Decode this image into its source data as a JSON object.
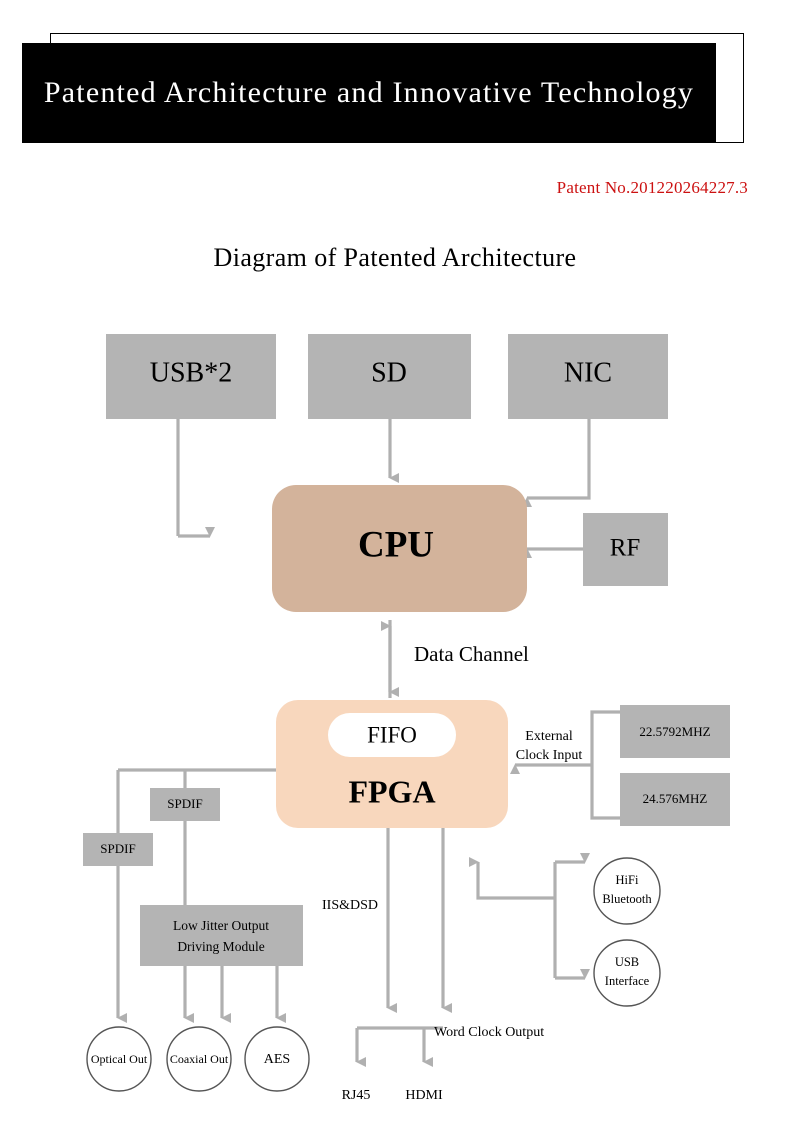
{
  "header": {
    "title": "Patented Architecture and Innovative Technology",
    "banner_bg": "#000000",
    "banner_text_color": "#ffffff"
  },
  "patent": {
    "label": "Patent No.201220264227.3",
    "color": "#cc1111"
  },
  "diagram": {
    "title": "Diagram of Patented Architecture",
    "colors": {
      "gray_box": "#b4b4b4",
      "cpu_fill": "#d3b39b",
      "fpga_fill": "#f8d7bd",
      "fifo_fill": "#ffffff",
      "connector": "#b0b0b0",
      "circle_stroke": "#555555"
    },
    "nodes": {
      "usb": "USB*2",
      "sd": "SD",
      "nic": "NIC",
      "cpu": "CPU",
      "rf": "RF",
      "fifo": "FIFO",
      "fpga": "FPGA",
      "clock_a": "22.5792MHZ",
      "clock_b": "24.576MHZ",
      "spdif_upper": "SPDIF",
      "spdif_lower": "SPDIF",
      "low_jitter_line1": "Low Jitter Output",
      "low_jitter_line2": "Driving Module",
      "optical_out": "Optical Out",
      "coaxial_out": "Coaxial Out",
      "aes": "AES",
      "hifi_bt_line1": "HiFi",
      "hifi_bt_line2": "Bluetooth",
      "usb_iface_line1": "USB",
      "usb_iface_line2": "Interface",
      "rj45": "RJ45",
      "hdmi": "HDMI"
    },
    "edge_labels": {
      "data_channel": "Data Channel",
      "external_clock_line1": "External",
      "external_clock_line2": "Clock Input",
      "iis_dsd": "IIS&DSD",
      "word_clock_output": "Word Clock Output"
    }
  }
}
